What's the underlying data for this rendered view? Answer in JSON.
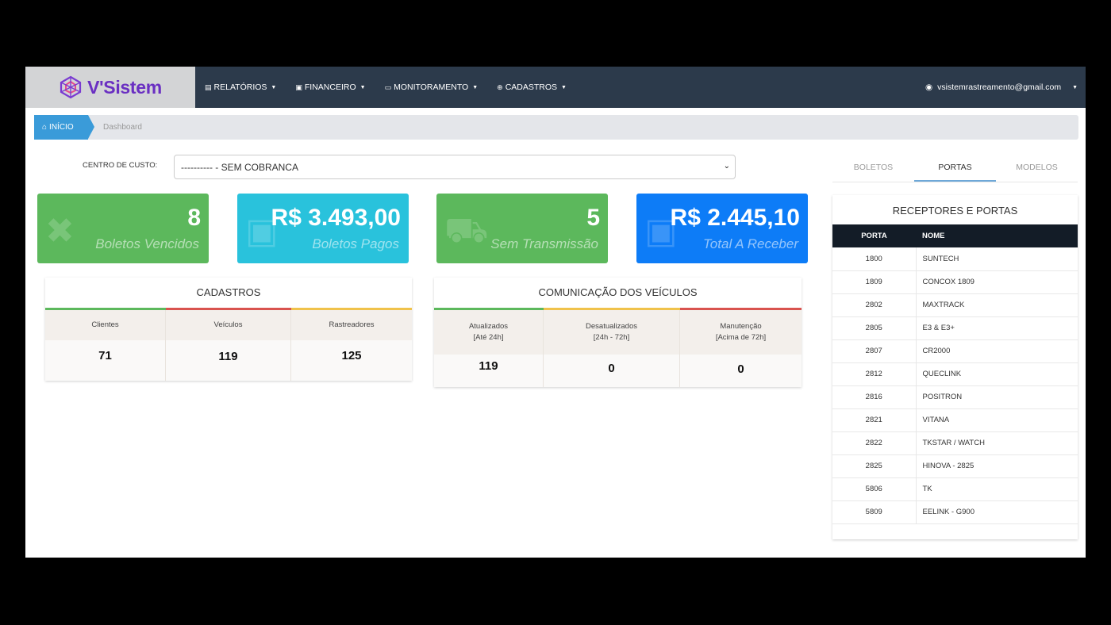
{
  "brand": {
    "name": "V'Sistem"
  },
  "nav": {
    "items": [
      {
        "label": "RELATÓRIOS",
        "icon": "file-icon"
      },
      {
        "label": "FINANCEIRO",
        "icon": "money-icon"
      },
      {
        "label": "MONITORAMENTO",
        "icon": "monitor-icon"
      },
      {
        "label": "CADASTROS",
        "icon": "plus-circle-icon"
      }
    ],
    "user_email": "vsistemrastreamento@gmail.com"
  },
  "breadcrumb": {
    "home": "INÍCIO",
    "current": "Dashboard"
  },
  "centro_custo": {
    "label": "CENTRO DE CUSTO:",
    "value": "---------- - SEM COBRANCA"
  },
  "stats": [
    {
      "value": "8",
      "label": "Boletos Vencidos",
      "icon": "close-icon",
      "color": "#5cb85c"
    },
    {
      "value": "R$ 3.493,00",
      "label": "Boletos Pagos",
      "icon": "money-icon",
      "color": "#29c2dc"
    },
    {
      "value": "5",
      "label": "Sem Transmissão",
      "icon": "truck-icon",
      "color": "#5cb85c"
    },
    {
      "value": "R$ 2.445,10",
      "label": "Total A Receber",
      "icon": "money-icon",
      "color": "#0d7cf7"
    }
  ],
  "cadastros": {
    "title": "CADASTROS",
    "columns": [
      {
        "label": "Clientes",
        "value": "71"
      },
      {
        "label": "Veículos",
        "value": "119"
      },
      {
        "label": "Rastreadores",
        "value": "125"
      }
    ]
  },
  "comunicacao": {
    "title": "COMUNICAÇÃO DOS VEÍCULOS",
    "columns": [
      {
        "label": "Atualizados",
        "sub": "[Até 24h]",
        "value": "119"
      },
      {
        "label": "Desatualizados",
        "sub": "[24h - 72h]",
        "value": "0"
      },
      {
        "label": "Manutenção",
        "sub": "[Acima de 72h]",
        "value": "0"
      }
    ]
  },
  "tabs": [
    "BOLETOS",
    "PORTAS",
    "MODELOS"
  ],
  "ports": {
    "title": "RECEPTORES E PORTAS",
    "headers": [
      "PORTA",
      "NOME"
    ],
    "rows": [
      [
        "1800",
        "SUNTECH"
      ],
      [
        "1809",
        "CONCOX 1809"
      ],
      [
        "2802",
        "MAXTRACK"
      ],
      [
        "2805",
        "E3 & E3+"
      ],
      [
        "2807",
        "CR2000"
      ],
      [
        "2812",
        "QUECLINK"
      ],
      [
        "2816",
        "POSITRON"
      ],
      [
        "2821",
        "VITANA"
      ],
      [
        "2822",
        "TKSTAR / WATCH"
      ],
      [
        "2825",
        "HINOVA - 2825"
      ],
      [
        "5806",
        "TK"
      ],
      [
        "5809",
        "EELINK - G900"
      ]
    ]
  },
  "colors": {
    "green": "#5cb85c",
    "red": "#d9534f",
    "yellow": "#f0c24b",
    "nav_bg": "#2c3a4b"
  }
}
